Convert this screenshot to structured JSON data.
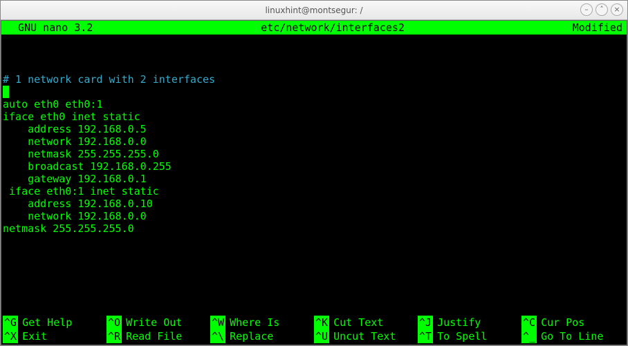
{
  "window": {
    "title": "linuxhint@montsegur: /"
  },
  "nano": {
    "version_label": "  GNU nano 3.2",
    "filename": "etc/network/interfaces2",
    "status": "Modified"
  },
  "content": {
    "comment_line": "# 1 network card with 2 interfaces",
    "lines": [
      "auto eth0 eth0:1",
      "iface eth0 inet static",
      "    address 192.168.0.5",
      "    network 192.168.0.0",
      "    netmask 255.255.255.0",
      "    broadcast 192.168.0.255",
      "    gateway 192.168.0.1",
      " iface eth0:1 inet static",
      "    address 192.168.0.10",
      "    network 192.168.0.0",
      "netmask 255.255.255.0"
    ]
  },
  "shortcuts": {
    "row1": [
      {
        "key": "^G",
        "label": "Get Help"
      },
      {
        "key": "^O",
        "label": "Write Out"
      },
      {
        "key": "^W",
        "label": "Where Is"
      },
      {
        "key": "^K",
        "label": "Cut Text"
      },
      {
        "key": "^J",
        "label": "Justify"
      },
      {
        "key": "^C",
        "label": "Cur Pos"
      }
    ],
    "row2": [
      {
        "key": "^X",
        "label": "Exit"
      },
      {
        "key": "^R",
        "label": "Read File"
      },
      {
        "key": "^\\",
        "label": "Replace"
      },
      {
        "key": "^U",
        "label": "Uncut Text"
      },
      {
        "key": "^T",
        "label": "To Spell"
      },
      {
        "key": "^_",
        "label": "Go To Line"
      }
    ]
  }
}
